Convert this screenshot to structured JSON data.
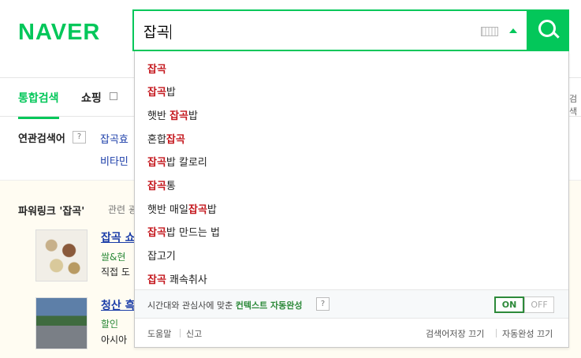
{
  "header": {
    "logo": "NAVER",
    "query": "잡곡"
  },
  "tabs": {
    "active": "통합검색",
    "shopping": "쇼핑",
    "right_partial": "검색"
  },
  "related": {
    "label": "연관검색어",
    "help": "?",
    "items": [
      "잡곡효",
      "비타민"
    ]
  },
  "powerlink": {
    "title": "파워링크 '잡곡'",
    "subtitle": "관련 광",
    "ads": [
      {
        "title": "잡곡 쇼",
        "line1": "쌀&현",
        "line2": "직접 도"
      },
      {
        "title": "청산 흑",
        "line1": "할인",
        "line1_rest": " ",
        "line2": "아시아"
      }
    ]
  },
  "autocomplete": {
    "suggestions": [
      {
        "hl": "잡곡",
        "rest": ""
      },
      {
        "hl": "잡곡",
        "rest": "밥"
      },
      {
        "pre": "햇반 ",
        "hl": "잡곡",
        "rest": "밥"
      },
      {
        "pre": "혼합",
        "hl": "잡곡",
        "rest": ""
      },
      {
        "hl": "잡곡",
        "rest": "밥 칼로리"
      },
      {
        "hl": "잡곡",
        "rest": "통"
      },
      {
        "pre": "햇반 매일",
        "hl": "잡곡",
        "rest": "밥"
      },
      {
        "hl": "잡곡",
        "rest": "밥 만드는 법"
      },
      {
        "pre": "잡고기",
        "hl": "",
        "rest": ""
      },
      {
        "hl": "잡곡",
        "rest": " 쾌속취사"
      }
    ],
    "context_text": "시간대와 관심사에 맞춘 ",
    "context_highlight": "컨텍스트 자동완성",
    "context_help": "?",
    "toggle_on": "ON",
    "toggle_off": "OFF",
    "footer": {
      "help": "도움말",
      "report": "신고",
      "save_off": "검색어저장 끄기",
      "autocomplete_off": "자동완성 끄기"
    }
  },
  "colors": {
    "brand": "#03c75a",
    "highlight": "#c4161c",
    "link": "#1a3ca8"
  }
}
